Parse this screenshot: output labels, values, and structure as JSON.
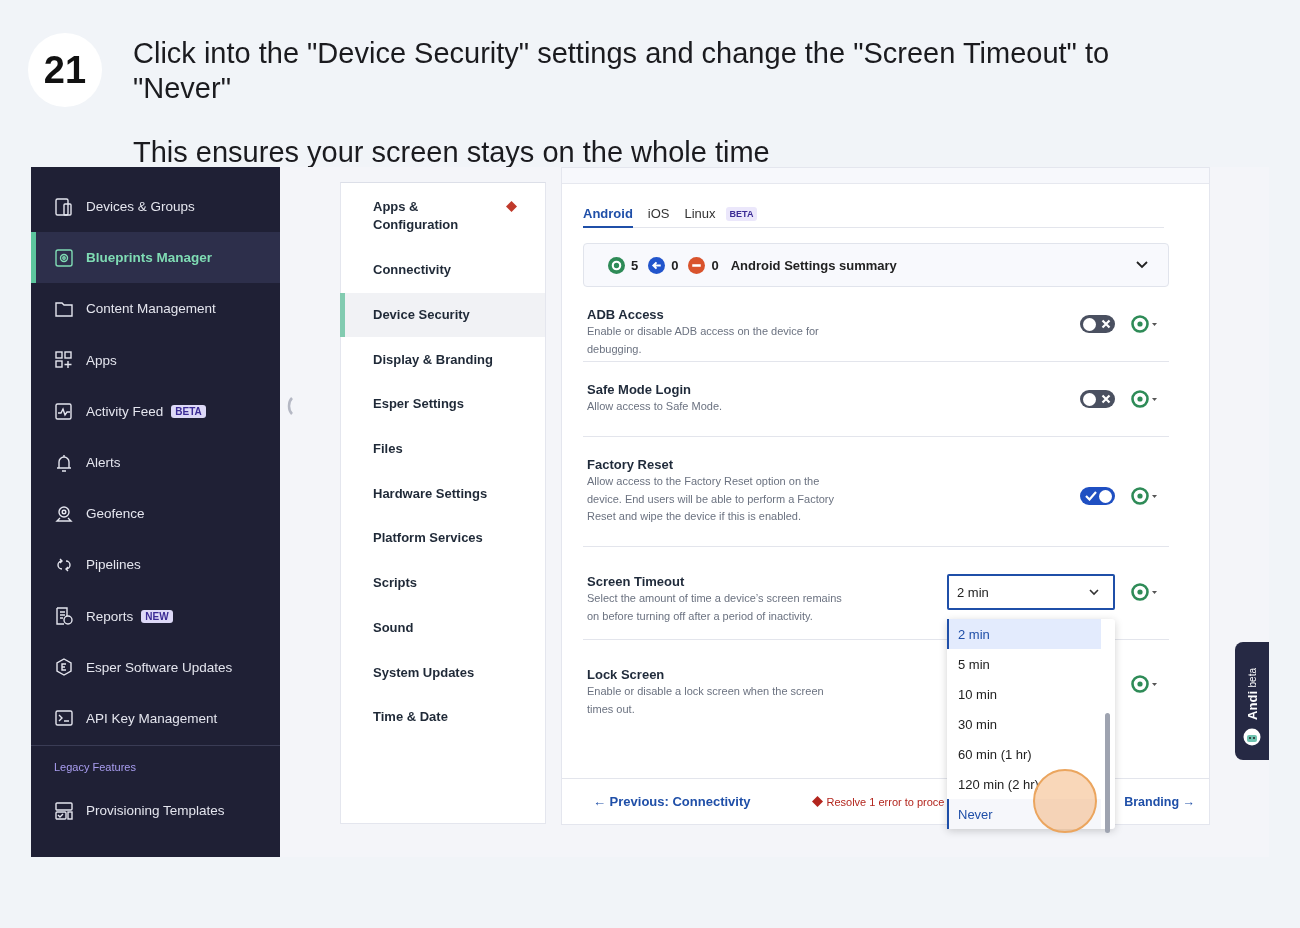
{
  "step": {
    "number": "21",
    "title": "Click into the \"Device Security\" settings and change the \"Screen Timeout\" to \"Never\"",
    "subtitle": "This ensures your screen stays on the whole time"
  },
  "sidebar": {
    "items": [
      {
        "label": "Devices & Groups",
        "selected": false
      },
      {
        "label": "Blueprints Manager",
        "selected": true
      },
      {
        "label": "Content Management",
        "selected": false
      },
      {
        "label": "Apps",
        "selected": false
      },
      {
        "label": "Activity Feed",
        "selected": false,
        "badge": "BETA"
      },
      {
        "label": "Alerts",
        "selected": false
      },
      {
        "label": "Geofence",
        "selected": false
      },
      {
        "label": "Pipelines",
        "selected": false
      },
      {
        "label": "Reports",
        "selected": false,
        "badge": "NEW"
      },
      {
        "label": "Esper Software Updates",
        "selected": false
      },
      {
        "label": "API Key Management",
        "selected": false
      }
    ],
    "section_label": "Legacy Features",
    "legacy_items": [
      {
        "label": "Provisioning Templates",
        "selected": false
      }
    ]
  },
  "settings_nav": {
    "items": [
      {
        "label": "Apps & Configuration",
        "selected": false,
        "error": true
      },
      {
        "label": "Connectivity",
        "selected": false,
        "error": false
      },
      {
        "label": "Device Security",
        "selected": true,
        "error": false
      },
      {
        "label": "Display & Branding",
        "selected": false,
        "error": false
      },
      {
        "label": "Esper Settings",
        "selected": false,
        "error": false
      },
      {
        "label": "Files",
        "selected": false,
        "error": false
      },
      {
        "label": "Hardware Settings",
        "selected": false,
        "error": false
      },
      {
        "label": "Platform Services",
        "selected": false,
        "error": false
      },
      {
        "label": "Scripts",
        "selected": false,
        "error": false
      },
      {
        "label": "Sound",
        "selected": false,
        "error": false
      },
      {
        "label": "System Updates",
        "selected": false,
        "error": false
      },
      {
        "label": "Time & Date",
        "selected": false,
        "error": false
      }
    ]
  },
  "platform_tabs": [
    {
      "label": "Android",
      "selected": true
    },
    {
      "label": "iOS",
      "selected": false
    },
    {
      "label": "Linux",
      "selected": false,
      "badge": "BETA"
    }
  ],
  "summary": {
    "counts": [
      {
        "kind": "applied",
        "value": "5"
      },
      {
        "kind": "override",
        "value": "0"
      },
      {
        "kind": "blocked",
        "value": "0"
      }
    ],
    "title": "Android Settings summary"
  },
  "settings": [
    {
      "kind": "toggle",
      "title": "ADB Access",
      "description": "Enable or disable ADB access on the device for debugging.",
      "on": false
    },
    {
      "kind": "toggle",
      "title": "Safe Mode Login",
      "description": "Allow access to Safe Mode.",
      "on": false
    },
    {
      "kind": "toggle",
      "title": "Factory Reset",
      "description": "Allow access to the Factory Reset option on the device. End users will be able to perform a Factory Reset and wipe the device if this is enabled.",
      "on": true
    },
    {
      "kind": "select",
      "title": "Screen Timeout",
      "description": "Select the amount of time a device’s screen remains on before turning off after a period of inactivity.",
      "value": "2 min",
      "expanded": true,
      "options": [
        {
          "label": "2 min",
          "selected": true,
          "hovered": false
        },
        {
          "label": "5 min",
          "selected": false,
          "hovered": false
        },
        {
          "label": "10 min",
          "selected": false,
          "hovered": false
        },
        {
          "label": "30 min",
          "selected": false,
          "hovered": false
        },
        {
          "label": "60 min (1 hr)",
          "selected": false,
          "hovered": false
        },
        {
          "label": "120 min (2 hr)",
          "selected": false,
          "hovered": false
        },
        {
          "label": "Never",
          "selected": false,
          "hovered": true
        }
      ]
    },
    {
      "kind": "covered",
      "title": "Lock Screen",
      "description": "Enable or disable a lock screen when the screen times out."
    }
  ],
  "footer": {
    "previous": "← Previous: Connectivity",
    "error": "Resolve 1 error to proce",
    "next": "Branding →"
  },
  "assistant_tab": {
    "label": "Andi",
    "badge": "beta"
  }
}
